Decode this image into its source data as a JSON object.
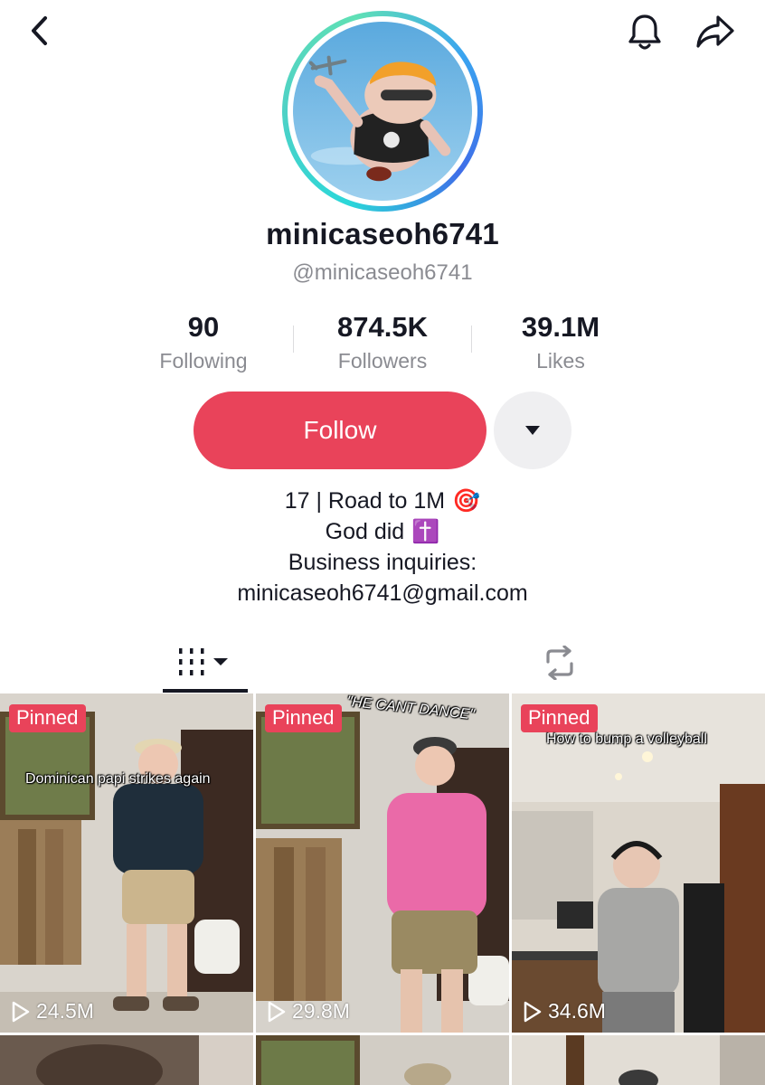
{
  "header": {
    "back_icon": "chevron-left-icon",
    "bell_icon": "bell-icon",
    "share_icon": "share-arrow-icon"
  },
  "profile": {
    "display_name": "minicaseoh6741",
    "username": "@minicaseoh6741",
    "ring_colors": [
      "#2bd7d9",
      "#3f6ee8"
    ]
  },
  "stats": {
    "following": {
      "count": "90",
      "label": "Following"
    },
    "followers": {
      "count": "874.5K",
      "label": "Followers"
    },
    "likes": {
      "count": "39.1M",
      "label": "Likes"
    }
  },
  "actions": {
    "follow_label": "Follow",
    "follow_color": "#e9435a",
    "more_icon": "caret-down-icon"
  },
  "bio": {
    "line1": "17 | Road to 1M",
    "line1_emoji": "🎯",
    "line2": "God did",
    "line2_emoji": "✝️",
    "line3": "Business inquiries:",
    "line4": "minicaseoh6741@gmail.com"
  },
  "tabs": [
    {
      "name": "videos",
      "icon": "grid-bars-icon",
      "active": true
    },
    {
      "name": "reposts",
      "icon": "repost-icon",
      "active": false
    }
  ],
  "videos": [
    {
      "pinned_label": "Pinned",
      "caption": "Dominican papi strikes again",
      "views": "24.5M"
    },
    {
      "pinned_label": "Pinned",
      "caption": "\"HE CANT DANCE\"",
      "views": "29.8M"
    },
    {
      "pinned_label": "Pinned",
      "caption": "How to bump a volleyball",
      "views": "34.6M"
    }
  ]
}
